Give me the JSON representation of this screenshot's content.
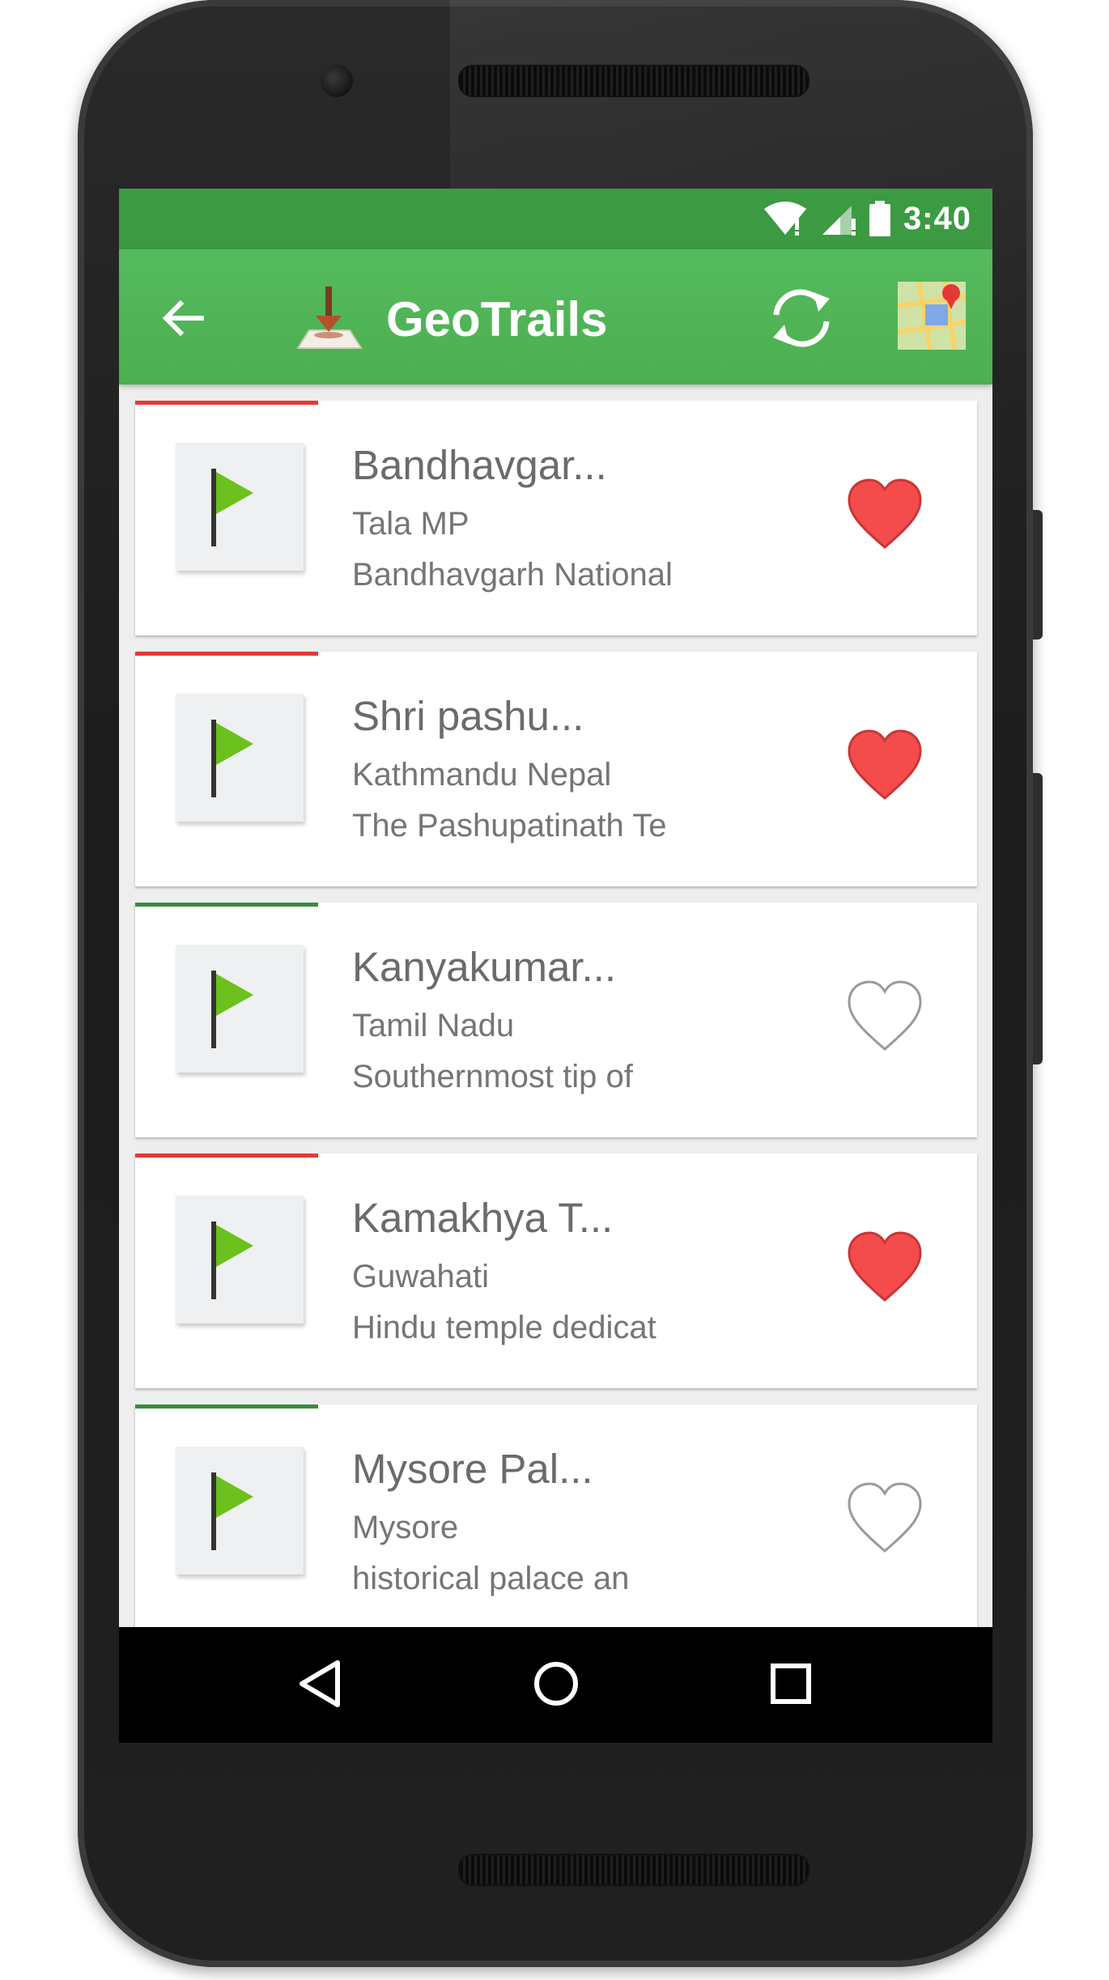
{
  "status_bar": {
    "time": "3:40",
    "icons": [
      "wifi-icon",
      "signal-icon",
      "battery-icon"
    ]
  },
  "app_bar": {
    "title": "GeoTrails",
    "back_icon": "back-arrow-icon",
    "logo_icon": "download-pin-icon",
    "sync_icon": "sync-icon",
    "map_icon": "map-icon"
  },
  "colors": {
    "status_bar": "#3c9a43",
    "app_bar": "#4caf50",
    "red": "#e53935",
    "green": "#388e3c",
    "heart_fill": "#f44336"
  },
  "trails": [
    {
      "name": "Bandhavgar...",
      "place": "Tala MP",
      "desc": "Bandhavgarh National",
      "favorite": true,
      "accent": "red"
    },
    {
      "name": "Shri pashu...",
      "place": "Kathmandu Nepal",
      "desc": "The Pashupatinath Te",
      "favorite": true,
      "accent": "red"
    },
    {
      "name": "Kanyakumar...",
      "place": "Tamil Nadu",
      "desc": "Southernmost tip of",
      "favorite": false,
      "accent": "green"
    },
    {
      "name": "Kamakhya T...",
      "place": "Guwahati",
      "desc": "Hindu temple dedicat",
      "favorite": true,
      "accent": "red"
    },
    {
      "name": "Mysore Pal...",
      "place": "Mysore",
      "desc": "historical palace an",
      "favorite": false,
      "accent": "green"
    }
  ],
  "nav_bar": {
    "back": "nav-back-icon",
    "home": "nav-home-icon",
    "recents": "nav-recents-icon"
  }
}
